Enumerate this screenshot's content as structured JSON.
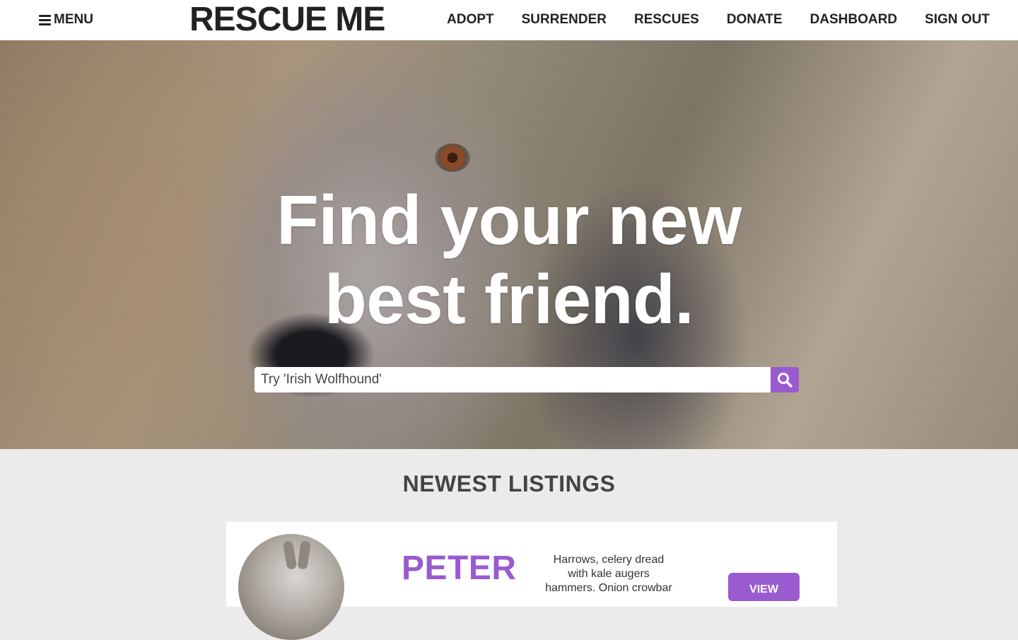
{
  "header": {
    "menu_label": "MENU",
    "brand": "RESCUE ME",
    "nav": [
      "ADOPT",
      "SURRENDER",
      "RESCUES",
      "DONATE",
      "DASHBOARD",
      "SIGN OUT"
    ]
  },
  "hero": {
    "title_line1": "Find your new",
    "title_line2": "best friend.",
    "search_placeholder": "Try 'Irish Wolfhound'"
  },
  "listings": {
    "title": "NEWEST LISTINGS",
    "items": [
      {
        "name": "PETER",
        "description": "Harrows, celery dread with kale augers hammers. Onion crowbar",
        "button_label": "VIEW"
      }
    ]
  },
  "colors": {
    "accent": "#9a5bd0",
    "header_bg": "#ffffff",
    "section_bg": "#ebebeb",
    "text_dark": "#222222"
  }
}
